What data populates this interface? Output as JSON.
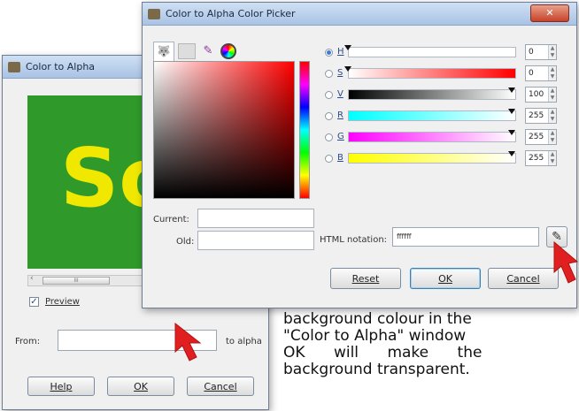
{
  "color_to_alpha": {
    "title": "Color to Alpha",
    "preview_label": "Preview",
    "preview_checked": true,
    "from_label": "From:",
    "from_value": "",
    "to_alpha_label": "to alpha",
    "help_label": "Help",
    "ok_label": "OK",
    "cancel_label": "Cancel",
    "preview_text": "So",
    "scroll_thumb": "III"
  },
  "picker": {
    "title": "Color to Alpha Color Picker",
    "channels": [
      {
        "name": "H",
        "value": "0",
        "selected": true
      },
      {
        "name": "S",
        "value": "0",
        "selected": false
      },
      {
        "name": "V",
        "value": "100",
        "selected": false
      },
      {
        "name": "R",
        "value": "255",
        "selected": false
      },
      {
        "name": "G",
        "value": "255",
        "selected": false
      },
      {
        "name": "B",
        "value": "255",
        "selected": false
      }
    ],
    "current_label": "Current:",
    "old_label": "Old:",
    "html_notation_label": "HTML notation:",
    "html_notation_value": "ffffff",
    "reset_label": "Reset",
    "ok_label": "OK",
    "cancel_label": "Cancel"
  },
  "caption": {
    "lines": [
      "background colour in the",
      "\"Color to Alpha\" window",
      "OK      will      make      the",
      "background transparent."
    ]
  },
  "colors": {
    "arrow": "#e02020",
    "preview_green": "#2f9a2a",
    "preview_text": "#f0e800"
  }
}
